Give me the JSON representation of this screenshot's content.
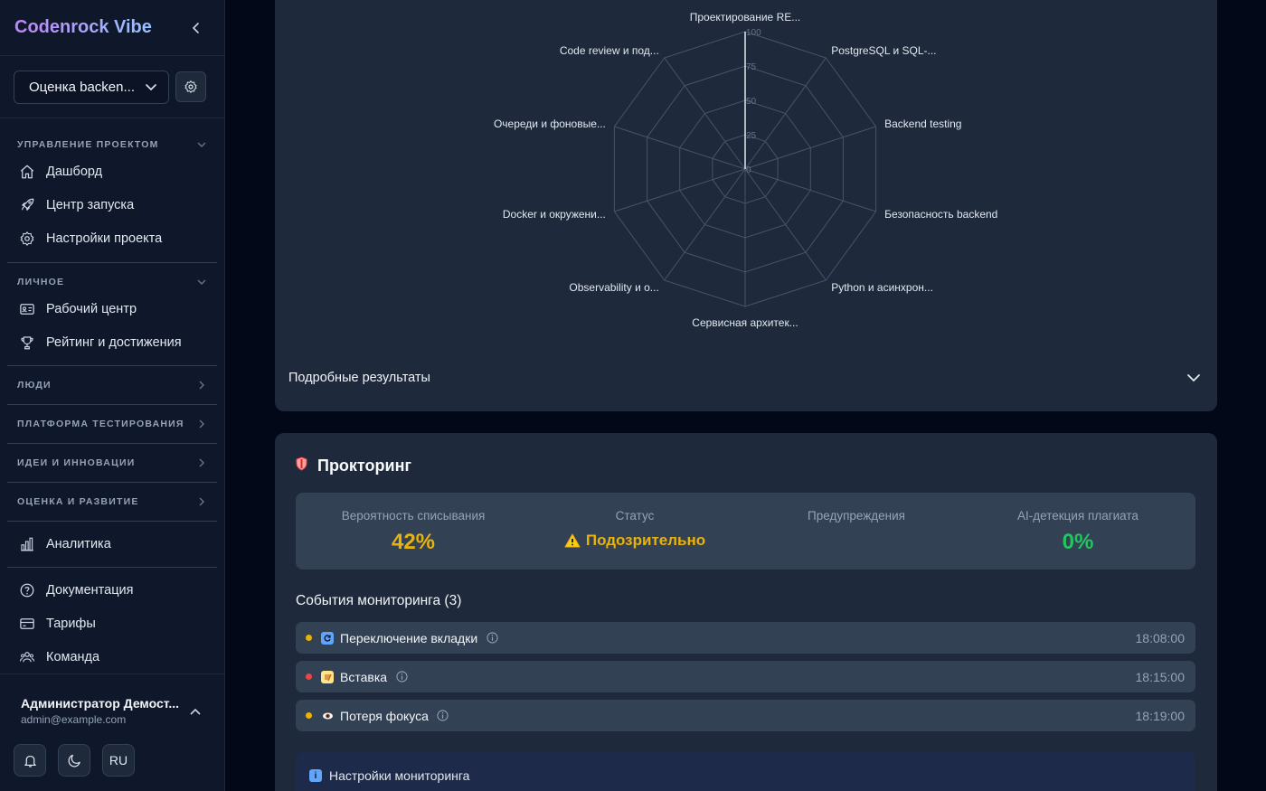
{
  "sidebar": {
    "brand": "Codenrock Vibe",
    "project_select": "Оценка backen...",
    "sections": [
      {
        "title": "УПРАВЛЕНИЕ ПРОЕКТОМ",
        "items": [
          "Дашборд",
          "Центр запуска",
          "Настройки проекта"
        ]
      },
      {
        "title": "ЛИЧНОЕ",
        "items": [
          "Рабочий центр",
          "Рейтинг и достижения"
        ]
      },
      {
        "title": "ЛЮДИ"
      },
      {
        "title": "ПЛАТФОРМА ТЕСТИРОВАНИЯ"
      },
      {
        "title": "ИДЕИ И ИННОВАЦИИ"
      },
      {
        "title": "ОЦЕНКА И РАЗВИТИЕ"
      }
    ],
    "analytics": "Аналитика",
    "bottom_items": [
      "Документация",
      "Тарифы",
      "Команда"
    ],
    "user": {
      "name": "Администратор Демост...",
      "email": "admin@example.com"
    },
    "footer": {
      "lang": "RU"
    }
  },
  "chart_data": {
    "type": "radar",
    "categories": [
      "Проектирование RE...",
      "PostgreSQL и SQL-...",
      "Backend testing",
      "Безопасность backend",
      "Python и асинхрон...",
      "Сервисная архитек...",
      "Observability и о...",
      "Docker и окружени...",
      "Очереди и фоновые...",
      "Code review и под..."
    ],
    "values": [
      100,
      0,
      0,
      0,
      0,
      0,
      0,
      0,
      0,
      0
    ],
    "ticks": [
      "0",
      "25",
      "50",
      "75",
      "100"
    ],
    "ylim": [
      0,
      100
    ],
    "colors": {
      "grid": "#475569",
      "series": "#e2e8f0"
    }
  },
  "results": {
    "title": "Подробные результаты"
  },
  "proctoring": {
    "title": "Прокторинг",
    "stats": {
      "cheat_label": "Вероятность списывания",
      "cheat_value": "42%",
      "status_label": "Статус",
      "status_value": "Подозрительно",
      "warnings_label": "Предупреждения",
      "ai_label": "AI-детекция плагиата",
      "ai_value": "0%"
    },
    "events_title": "События мониторинга (3)",
    "events": [
      {
        "label": "Переключение вкладки",
        "time": "18:08:00",
        "color": "#eab308"
      },
      {
        "label": "Вставка",
        "time": "18:15:00",
        "color": "#ef4444"
      },
      {
        "label": "Потеря фокуса",
        "time": "18:19:00",
        "color": "#eab308"
      }
    ],
    "settings_label": "Настройки мониторинга"
  }
}
